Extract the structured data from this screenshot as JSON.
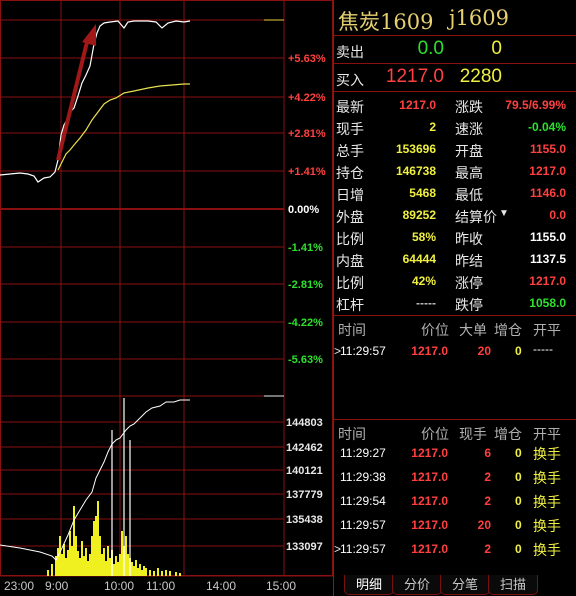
{
  "title": {
    "name": "焦炭1609",
    "code": "j1609"
  },
  "quote": {
    "sell": {
      "label": "卖出",
      "price": "0.0",
      "volume": "0"
    },
    "buy": {
      "label": "买入",
      "price": "1217.0",
      "volume": "2280"
    }
  },
  "stats": [
    {
      "l1": "最新",
      "v1": "1217.0",
      "c1": "red",
      "l2": "涨跌",
      "v2": "79.5/6.99%",
      "c2": "red"
    },
    {
      "l1": "现手",
      "v1": "2",
      "c1": "yellow",
      "l2": "速涨",
      "v2": "-0.04%",
      "c2": "green"
    },
    {
      "l1": "总手",
      "v1": "153696",
      "c1": "yellow",
      "l2": "开盘",
      "v2": "1155.0",
      "c2": "red"
    },
    {
      "l1": "持仓",
      "v1": "146738",
      "c1": "yellow",
      "l2": "最高",
      "v2": "1217.0",
      "c2": "red"
    },
    {
      "l1": "日增",
      "v1": "5468",
      "c1": "yellow",
      "l2": "最低",
      "v2": "1146.0",
      "c2": "red"
    },
    {
      "l1": "外盘",
      "v1": "89252",
      "c1": "yellow",
      "l2": "结算价",
      "v2": "0.0",
      "c2": "red"
    },
    {
      "l1": "比例",
      "v1": "58%",
      "c1": "yellow",
      "l2": "昨收",
      "v2": "1155.0",
      "c2": "white"
    },
    {
      "l1": "内盘",
      "v1": "64444",
      "c1": "yellow",
      "l2": "昨结",
      "v2": "1137.5",
      "c2": "white"
    },
    {
      "l1": "比例",
      "v1": "42%",
      "c1": "yellow",
      "l2": "涨停",
      "v2": "1217.0",
      "c2": "red"
    },
    {
      "l1": "杠杆",
      "v1": "-----",
      "c1": "gray",
      "l2": "跌停",
      "v2": "1058.0",
      "c2": "green"
    }
  ],
  "big_orders": {
    "headers": [
      "时间",
      "价位",
      "大单",
      "增仓",
      "开平"
    ],
    "rows": [
      {
        "time": "11:29:57",
        "price": "1217.0",
        "vol": "20",
        "inc": "0",
        "type": "-----"
      }
    ]
  },
  "ticks": {
    "headers": [
      "时间",
      "价位",
      "现手",
      "增仓",
      "开平"
    ],
    "rows": [
      {
        "time": "11:29:27",
        "price": "1217.0",
        "vol": "6",
        "inc": "0",
        "type": "换手"
      },
      {
        "time": "11:29:38",
        "price": "1217.0",
        "vol": "2",
        "inc": "0",
        "type": "换手"
      },
      {
        "time": "11:29:54",
        "price": "1217.0",
        "vol": "2",
        "inc": "0",
        "type": "换手"
      },
      {
        "time": "11:29:57",
        "price": "1217.0",
        "vol": "20",
        "inc": "0",
        "type": "换手"
      },
      {
        "time": "11:29:57",
        "price": "1217.0",
        "vol": "2",
        "inc": "0",
        "type": "换手"
      }
    ]
  },
  "tabs": [
    "明细",
    "分价",
    "分笔",
    "扫描"
  ],
  "chart_data": {
    "type": "line",
    "pct_axis": [
      "+5.63%",
      "+4.22%",
      "+2.81%",
      "+1.41%",
      "0.00%",
      "-1.41%",
      "-2.81%",
      "-4.22%",
      "-5.63%"
    ],
    "volume_axis": [
      "144803",
      "142462",
      "140121",
      "137779",
      "135438",
      "133097"
    ],
    "time_axis": [
      "23:00",
      "9:00",
      "10:00",
      "11:00",
      "14:00",
      "15:00"
    ],
    "colors": {
      "price": "#ffffff",
      "average": "#e8e050",
      "volume": "#f0f020",
      "grid": "#8a1010",
      "arrow": "#a01818"
    }
  }
}
